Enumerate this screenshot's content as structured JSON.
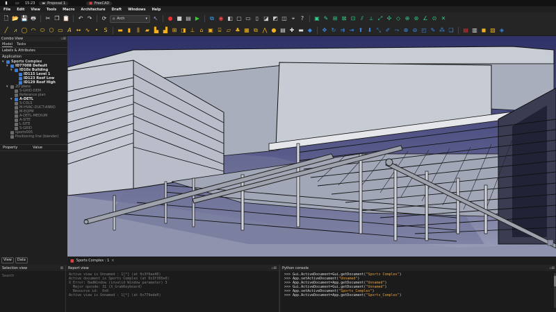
{
  "system_bar": {
    "time": "15:23",
    "task": "Proposal 1",
    "app": "FreeCAD"
  },
  "menus": [
    "File",
    "Edit",
    "View",
    "Tools",
    "Macro",
    "Architecture",
    "Draft",
    "Windows",
    "Help"
  ],
  "workbench": {
    "selected": "Arch"
  },
  "combo_view": {
    "title": "Combo View",
    "tabs": [
      "Model",
      "Tasks"
    ],
    "section": "Labels & Attributes",
    "group": "Application",
    "tree": [
      {
        "label": "Sports Complex",
        "level": 0,
        "color": "#c8c8c8",
        "bold": true
      },
      {
        "label": "ID77008 Default",
        "level": 1,
        "color": "#e0e0e0",
        "bold": true
      },
      {
        "label": "ID10x Building",
        "level": 2,
        "color": "#e0e0e0",
        "bold": true
      },
      {
        "label": "ID115 Level 1",
        "level": 3,
        "color": "#e0e0e0",
        "bold": true
      },
      {
        "label": "ID123 Roof Low",
        "level": 3,
        "color": "#e0e0e0",
        "bold": true
      },
      {
        "label": "ID129 Roof High",
        "level": 3,
        "color": "#e0e0e0",
        "bold": true
      },
      {
        "label": "2D plans",
        "level": 1,
        "color": "#9a9a9a",
        "bold": false
      },
      {
        "label": "S-GRID-DEM",
        "level": 2,
        "color": "#8a8a8a",
        "bold": false
      },
      {
        "label": "Reference plan",
        "level": 2,
        "color": "#8a8a8a",
        "bold": false
      },
      {
        "label": "A-DETL",
        "level": 2,
        "color": "#e0e0e0",
        "bold": true
      },
      {
        "label": "S-COLS",
        "level": 2,
        "color": "#8a8a8a",
        "bold": false
      },
      {
        "label": "M-HVAC-DUCT-ANNO",
        "level": 2,
        "color": "#8a8a8a",
        "bold": false
      },
      {
        "label": "M-EQPM",
        "level": 2,
        "color": "#8a8a8a",
        "bold": false
      },
      {
        "label": "A-DETL-MEDIUM",
        "level": 2,
        "color": "#8a8a8a",
        "bold": false
      },
      {
        "label": "A-SITE",
        "level": 2,
        "color": "#8a8a8a",
        "bold": false
      },
      {
        "label": "L-SITE",
        "level": 2,
        "color": "#8a8a8a",
        "bold": false
      },
      {
        "label": "S-GRID",
        "level": 2,
        "color": "#8a8a8a",
        "bold": false
      },
      {
        "label": "sports005",
        "level": 1,
        "color": "#8a8a8a",
        "bold": false
      },
      {
        "label": "Positioning line (blender)",
        "level": 1,
        "color": "#8a8a8a",
        "bold": false
      }
    ],
    "property_headers": [
      "Property",
      "Value"
    ],
    "bottom_tabs": [
      "View",
      "Data"
    ]
  },
  "viewport_tab": "Sports Complex : 1",
  "selection_view": {
    "title": "Selection view",
    "search_placeholder": "Search"
  },
  "report_view": {
    "title": "Report view",
    "lines": [
      "Active view is Unnamed : 1[*] (at 0x3f6ee40)",
      "Active document is Sports Complex (at 0x3f305e0)",
      "X Error: BadWindow (invalid Window parameter) 3",
      "  Major opcode: 31 (X_GrabKeyboard)",
      "  Resource id:  0x0",
      "Active view is Unnamed : 1[*] (at 0x779ede0)"
    ]
  },
  "python_console": {
    "title": "Python console",
    "lines": [
      {
        "pre": ">>> Gui.ActiveDocument=Gui.getDocument(",
        "arg": "\"Sports Complex\"",
        "post": ")"
      },
      {
        "pre": ">>> App.setActiveDocument(",
        "arg": "\"Unnamed\"",
        "post": ")"
      },
      {
        "pre": ">>> App.ActiveDocument=App.getDocument(",
        "arg": "\"Unnamed\"",
        "post": ")"
      },
      {
        "pre": ">>> Gui.ActiveDocument=Gui.getDocument(",
        "arg": "\"Unnamed\"",
        "post": ")"
      },
      {
        "pre": ">>> App.setActiveDocument(",
        "arg": "\"Sports_Complex\"",
        "post": ")"
      },
      {
        "pre": ">>> App.ActiveDocument=App.getDocument(",
        "arg": "\"Sports_Complex\"",
        "post": ")"
      }
    ]
  },
  "colors": {
    "accent_orange": "#f0a030",
    "python_string": "#e8a040",
    "report_text": "#7f7f7f"
  }
}
